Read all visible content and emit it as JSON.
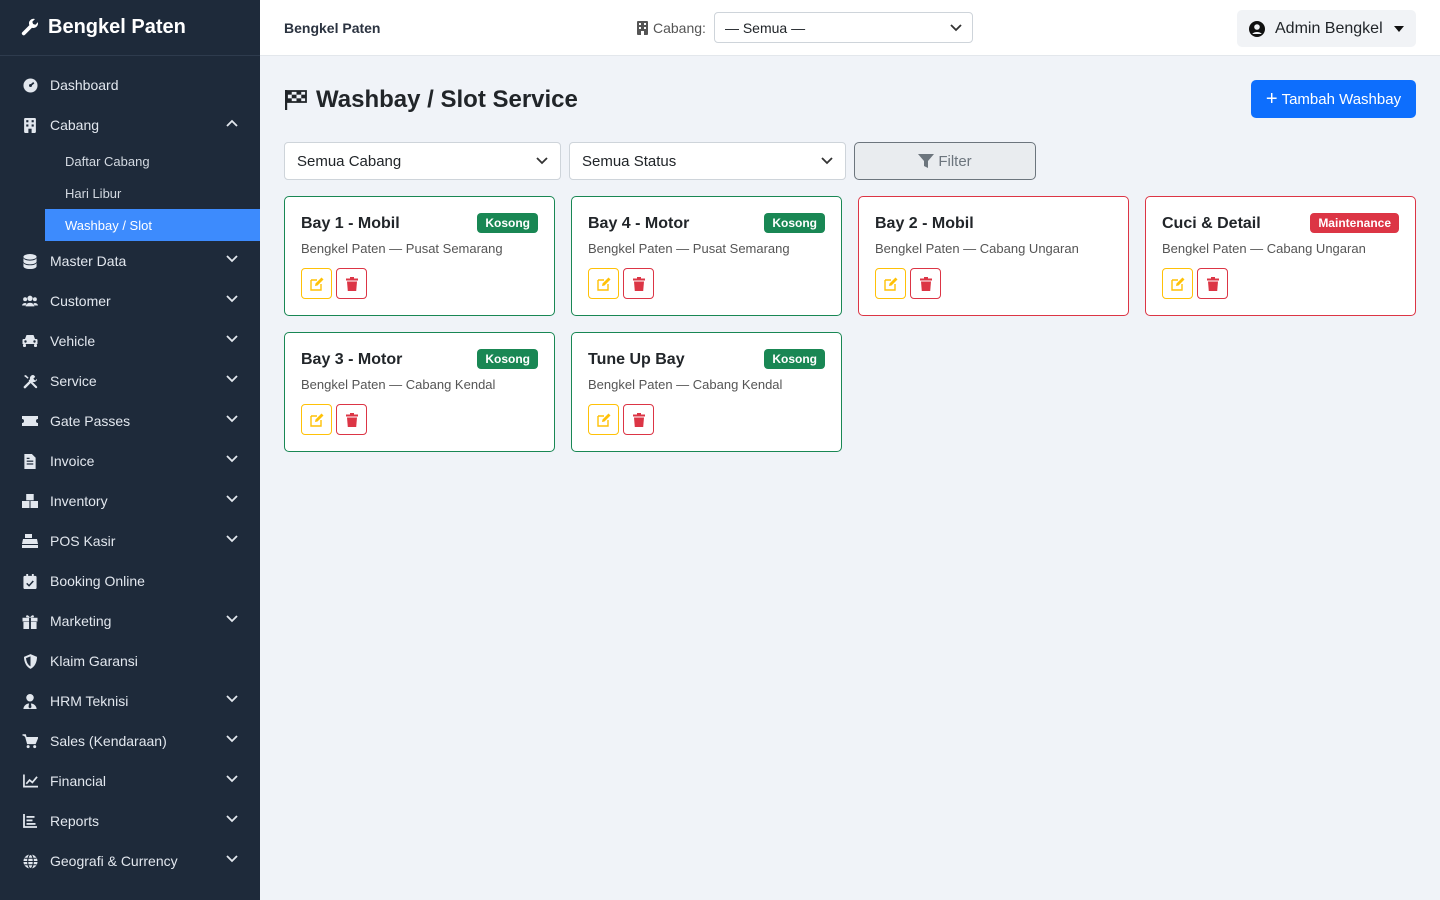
{
  "brand": {
    "name": "Bengkel Paten",
    "icon": "wrench-icon"
  },
  "sidebar": {
    "items": [
      {
        "label": "Dashboard",
        "icon": "dashboard-icon",
        "expandable": false
      },
      {
        "label": "Cabang",
        "icon": "building-icon",
        "expandable": true,
        "expanded": true,
        "children": [
          {
            "label": "Daftar Cabang",
            "active": false
          },
          {
            "label": "Hari Libur",
            "active": false
          },
          {
            "label": "Washbay / Slot",
            "active": true
          }
        ]
      },
      {
        "label": "Master Data",
        "icon": "database-icon",
        "expandable": true
      },
      {
        "label": "Customer",
        "icon": "users-icon",
        "expandable": true
      },
      {
        "label": "Vehicle",
        "icon": "car-icon",
        "expandable": true
      },
      {
        "label": "Service",
        "icon": "tools-icon",
        "expandable": true
      },
      {
        "label": "Gate Passes",
        "icon": "ticket-icon",
        "expandable": true
      },
      {
        "label": "Invoice",
        "icon": "invoice-icon",
        "expandable": true
      },
      {
        "label": "Inventory",
        "icon": "boxes-icon",
        "expandable": true
      },
      {
        "label": "POS Kasir",
        "icon": "cash-register-icon",
        "expandable": true
      },
      {
        "label": "Booking Online",
        "icon": "calendar-check-icon",
        "expandable": false
      },
      {
        "label": "Marketing",
        "icon": "gift-icon",
        "expandable": true
      },
      {
        "label": "Klaim Garansi",
        "icon": "shield-icon",
        "expandable": false
      },
      {
        "label": "HRM Teknisi",
        "icon": "user-tie-icon",
        "expandable": true
      },
      {
        "label": "Sales (Kendaraan)",
        "icon": "cart-icon",
        "expandable": true
      },
      {
        "label": "Financial",
        "icon": "chart-line-icon",
        "expandable": true
      },
      {
        "label": "Reports",
        "icon": "report-icon",
        "expandable": true
      },
      {
        "label": "Geografi & Currency",
        "icon": "globe-icon",
        "expandable": true
      }
    ]
  },
  "topbar": {
    "title": "Bengkel Paten",
    "cabang_label": "Cabang:",
    "cabang_value": "— Semua —",
    "user": "Admin Bengkel"
  },
  "page": {
    "title": "Washbay / Slot Service",
    "add_button": "Tambah Washbay",
    "filter_cabang": "Semua Cabang",
    "filter_status": "Semua Status",
    "filter_button": "Filter"
  },
  "washbays": [
    {
      "name": "Bay 1 - Mobil",
      "location": "Bengkel Paten — Pusat Semarang",
      "status": "Kosong",
      "status_color": "#198754"
    },
    {
      "name": "Bay 4 - Motor",
      "location": "Bengkel Paten — Pusat Semarang",
      "status": "Kosong",
      "status_color": "#198754"
    },
    {
      "name": "Bay 2 - Mobil",
      "location": "Bengkel Paten — Cabang Ungaran",
      "status": "",
      "status_color": "#dc3545"
    },
    {
      "name": "Cuci & Detail",
      "location": "Bengkel Paten — Cabang Ungaran",
      "status": "Maintenance",
      "status_color": "#dc3545"
    },
    {
      "name": "Bay 3 - Motor",
      "location": "Bengkel Paten — Cabang Kendal",
      "status": "Kosong",
      "status_color": "#198754"
    },
    {
      "name": "Tune Up Bay",
      "location": "Bengkel Paten — Cabang Kendal",
      "status": "Kosong",
      "status_color": "#198754"
    }
  ],
  "colors": {
    "sidebar_bg": "#1e2a3a",
    "active": "#3d8bfd",
    "primary": "#0d6efd",
    "success": "#198754",
    "danger": "#dc3545",
    "warning": "#ffc107"
  }
}
